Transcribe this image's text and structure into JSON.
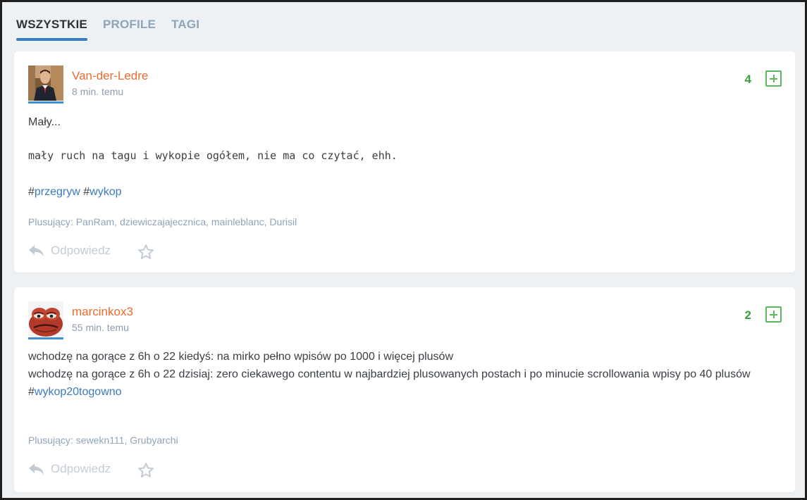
{
  "tabs": [
    {
      "label": "WSZYSTKIE",
      "active": true
    },
    {
      "label": "PROFILE",
      "active": false
    },
    {
      "label": "TAGI",
      "active": false
    }
  ],
  "posts": [
    {
      "username": "Van-der-Ledre",
      "time": "8 min. temu",
      "votes": "4",
      "title_line": "Mały...",
      "body_mono": "mały ruch na tagu i wykopie ogółem, nie ma co czytać, ehh.",
      "tags": [
        "przegryw",
        "wykop"
      ],
      "voters": "Plusujący: PanRam, dziewiczajajecznica, mainleblanc, Durisil",
      "reply_label": "Odpowiedz"
    },
    {
      "username": "marcinkox3",
      "time": "55 min. temu",
      "votes": "2",
      "line1": "wchodzę na gorące z 6h o 22 kiedyś: na mirko pełno wpisów po 1000 i więcej plusów",
      "line2": "wchodzę na gorące z 6h o 22 dzisiaj: zero ciekawego contentu w najbardziej plusowanych postach i po minucie scrollowania wpisy po 40 plusów",
      "tags": [
        "wykop20togowno"
      ],
      "voters": "Plusujący: sewekn111, Grubyarchi",
      "reply_label": "Odpowiedz"
    }
  ],
  "icons": {
    "reply": "reply-arrow-icon",
    "star": "star-outline-icon",
    "plus": "plus-square-icon"
  },
  "colors": {
    "username": "#ea6b2d",
    "tag": "#3b7bbf",
    "votes": "#3a9d3a",
    "active_tab_underline": "#3b7bbf"
  }
}
